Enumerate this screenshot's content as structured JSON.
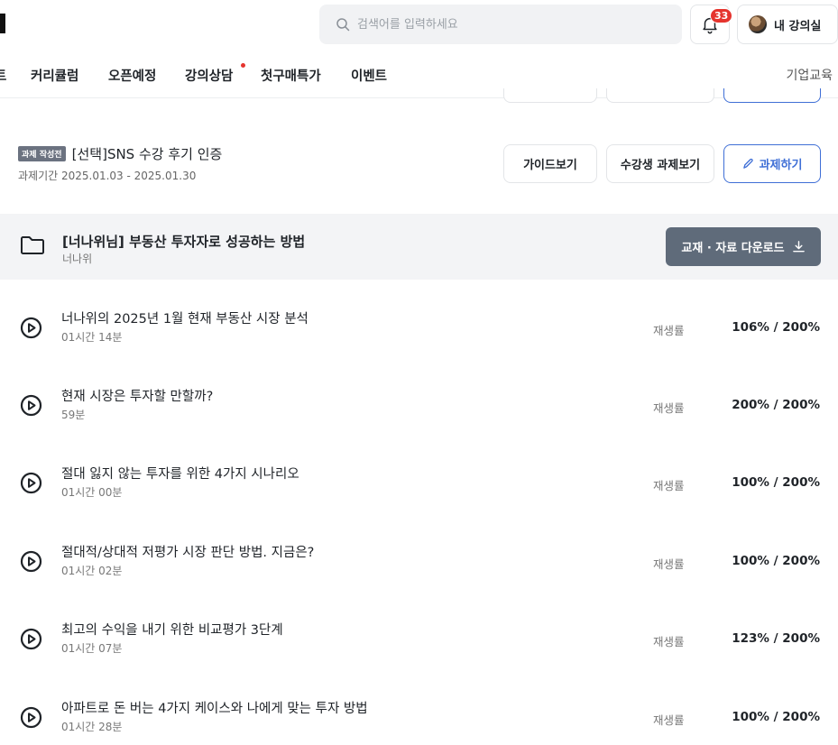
{
  "header": {
    "search_placeholder": "검색어를 입력하세요",
    "notification_count": "33",
    "my_room_label": "내 강의실",
    "nav": [
      {
        "label": "트"
      },
      {
        "label": "커리큘럼"
      },
      {
        "label": "오픈예정"
      },
      {
        "label": "강의상담"
      },
      {
        "label": "첫구매특가"
      },
      {
        "label": "이벤트"
      }
    ],
    "nav_right": "기업교육"
  },
  "assignment": {
    "tag": "과제 작성전",
    "title": "[선택]SNS 수강 후기 인증",
    "period": "과제기간 2025.01.03 - 2025.01.30",
    "guide_button": "가이드보기",
    "view_button": "수강생 과제보기",
    "do_button": "과제하기"
  },
  "section": {
    "title": "[너나위님] 부동산 투자자로 성공하는 방법",
    "instructor": "너나위",
    "download_label": "교재 · 자료 다운로드"
  },
  "lectures": [
    {
      "title": "너나위의 2025년 1월 현재 부동산 시장 분석",
      "duration": "01시간 14분",
      "rate_label": "재생률",
      "rate": "106% / 200%"
    },
    {
      "title": "현재 시장은 투자할 만할까?",
      "duration": "59분",
      "rate_label": "재생률",
      "rate": "200% / 200%"
    },
    {
      "title": "절대 잃지 않는 투자를 위한 4가지 시나리오",
      "duration": "01시간 00분",
      "rate_label": "재생률",
      "rate": "100% / 200%"
    },
    {
      "title": "절대적/상대적 저평가 시장 판단 방법. 지금은?",
      "duration": "01시간 02분",
      "rate_label": "재생률",
      "rate": "100% / 200%"
    },
    {
      "title": "최고의 수익을 내기 위한 비교평가 3단계",
      "duration": "01시간 07분",
      "rate_label": "재생률",
      "rate": "123% / 200%"
    },
    {
      "title": "아파트로 돈 버는 4가지 케이스와 나에게 맞는 투자 방법",
      "duration": "01시간 28분",
      "rate_label": "재생률",
      "rate": "100% / 200%"
    }
  ],
  "colors": {
    "accent": "#3f6fd6",
    "badge": "#e5342e",
    "download_bg": "#5f6b7a",
    "section_bg": "#f3f4f6"
  }
}
